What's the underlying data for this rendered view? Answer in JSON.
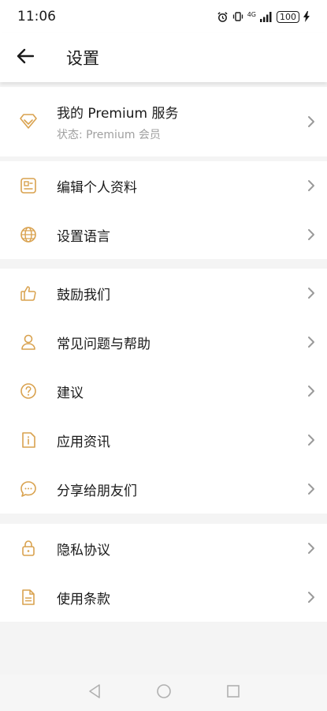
{
  "status_bar": {
    "time": "11:06",
    "network": "4G",
    "battery": "100"
  },
  "header": {
    "title": "设置"
  },
  "premium": {
    "title": "我的 Premium 服务",
    "subtitle": "状态:  Premium 会员",
    "icon": "diamond-icon"
  },
  "groups": [
    {
      "items": [
        {
          "label": "编辑个人资料",
          "icon": "profile-card-icon"
        },
        {
          "label": "设置语言",
          "icon": "globe-icon"
        }
      ]
    },
    {
      "items": [
        {
          "label": "鼓励我们",
          "icon": "thumbs-up-icon"
        },
        {
          "label": "常见问题与帮助",
          "icon": "person-icon"
        },
        {
          "label": "建议",
          "icon": "question-icon"
        },
        {
          "label": "应用资讯",
          "icon": "info-doc-icon"
        },
        {
          "label": "分享给朋友们",
          "icon": "chat-bubble-icon"
        }
      ]
    },
    {
      "items": [
        {
          "label": "隐私协议",
          "icon": "lock-icon"
        },
        {
          "label": "使用条款",
          "icon": "document-icon"
        }
      ]
    }
  ],
  "colors": {
    "accent": "#d9a24f",
    "background": "#f4f4f4",
    "surface": "#ffffff",
    "chevron": "#9a9a9a"
  }
}
